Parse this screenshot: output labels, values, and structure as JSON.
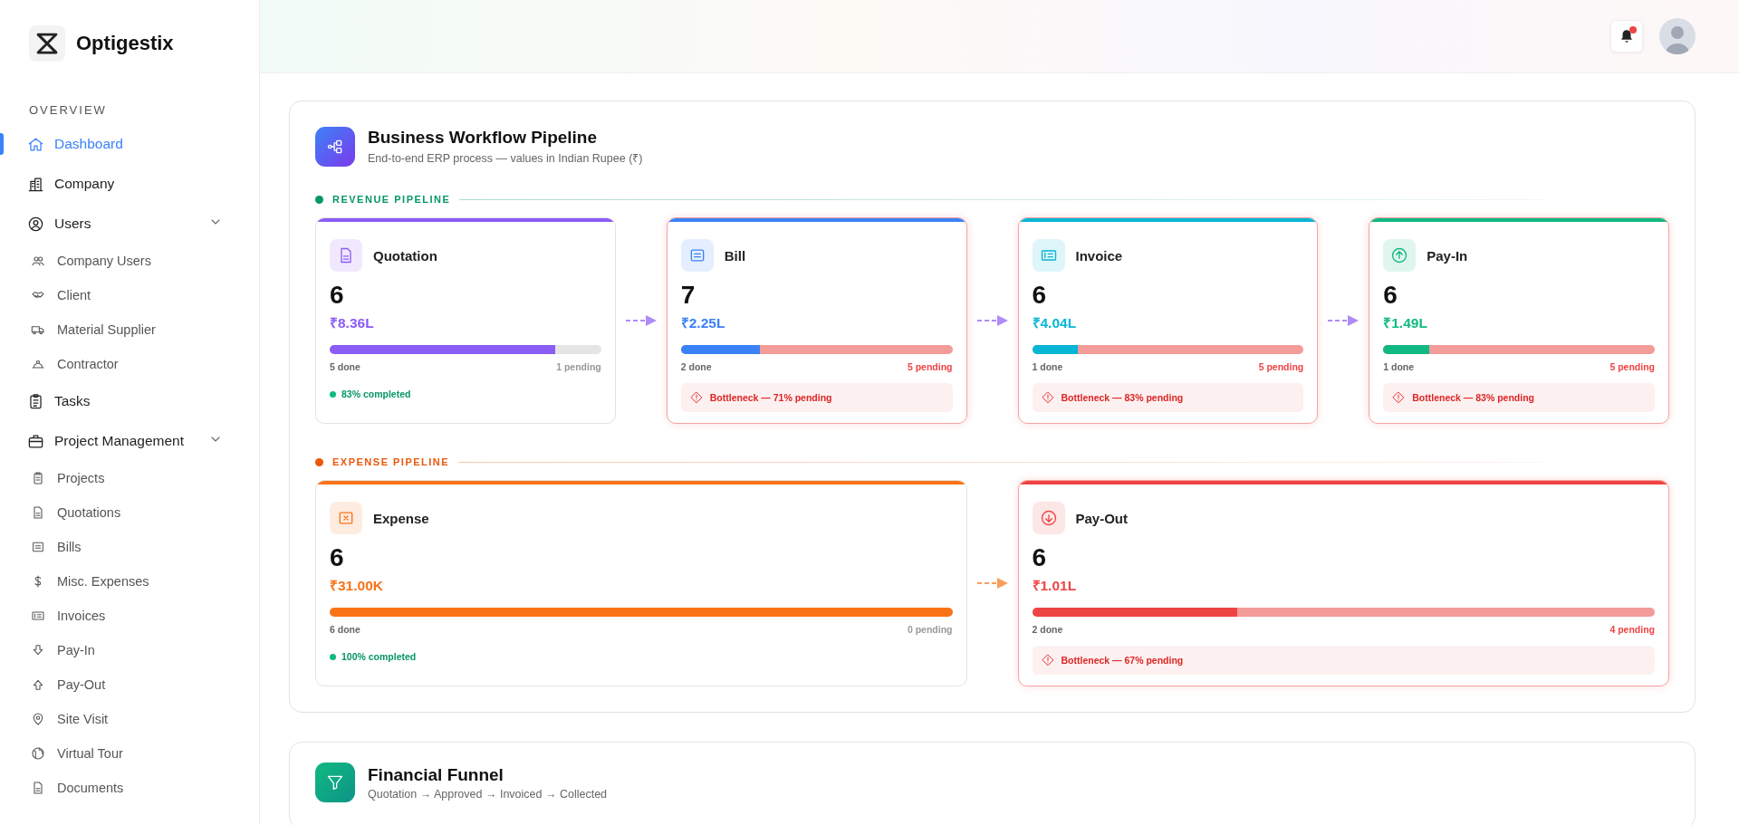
{
  "sidebar": {
    "brand": "Optigestix",
    "section_label": "OVERVIEW",
    "items": [
      {
        "label": "Dashboard",
        "selected": true
      },
      {
        "label": "Company",
        "selected": false
      },
      {
        "label": "Users",
        "selected": false,
        "expanded": true,
        "children": [
          {
            "label": "Company Users",
            "selected": false
          },
          {
            "label": "Client",
            "selected": false
          },
          {
            "label": "Material Supplier",
            "selected": false
          },
          {
            "label": "Contractor",
            "selected": false
          }
        ]
      },
      {
        "label": "Tasks",
        "selected": false
      },
      {
        "label": "Project Management",
        "selected": false,
        "expanded": true,
        "children": [
          {
            "label": "Projects",
            "selected": false
          },
          {
            "label": "Quotations",
            "selected": false
          },
          {
            "label": "Bills",
            "selected": false
          },
          {
            "label": "Misc. Expenses",
            "selected": false
          },
          {
            "label": "Invoices",
            "selected": false
          },
          {
            "label": "Pay-In",
            "selected": false
          },
          {
            "label": "Pay-Out",
            "selected": false
          },
          {
            "label": "Site Visit",
            "selected": false
          },
          {
            "label": "Virtual Tour",
            "selected": false
          },
          {
            "label": "Documents",
            "selected": false
          }
        ]
      }
    ]
  },
  "header": {
    "notifications_unread": true
  },
  "pipeline": {
    "title": "Business Workflow Pipeline",
    "subtitle": "End-to-end ERP process — values in Indian Rupee (₹)",
    "sections": [
      {
        "label": "REVENUE PIPELINE",
        "color": "#059669",
        "stages": [
          {
            "name": "Quotation",
            "kind": "complete",
            "color": "#8b5cf6",
            "count": "6",
            "amount": "₹8.36L",
            "level": 0.83,
            "done": "5 done",
            "pending": "1 pending",
            "note": "83% completed"
          },
          {
            "name": "Bill",
            "kind": "bottleneck",
            "color": "#3b82f6",
            "count": "7",
            "amount": "₹2.25L",
            "level": 0.29,
            "done": "2 done",
            "pending": "5 pending",
            "note": "Bottleneck — 71% pending"
          },
          {
            "name": "Invoice",
            "kind": "bottleneck",
            "color": "#06b6d4",
            "count": "6",
            "amount": "₹4.04L",
            "level": 0.17,
            "done": "1 done",
            "pending": "5 pending",
            "note": "Bottleneck — 83% pending"
          },
          {
            "name": "Pay-In",
            "kind": "bottleneck",
            "color": "#10b981",
            "count": "6",
            "amount": "₹1.49L",
            "level": 0.17,
            "done": "1 done",
            "pending": "5 pending",
            "note": "Bottleneck — 83% pending"
          }
        ]
      },
      {
        "label": "EXPENSE PIPELINE",
        "color": "#ea580c",
        "stages": [
          {
            "name": "Expense",
            "kind": "complete",
            "color": "#f97316",
            "count": "6",
            "amount": "₹31.00K",
            "level": 1,
            "done": "6 done",
            "pending": "0 pending",
            "note": "100% completed"
          },
          {
            "name": "Pay-Out",
            "kind": "bottleneck",
            "color": "#ef4444",
            "count": "6",
            "amount": "₹1.01L",
            "level": 0.33,
            "done": "2 done",
            "pending": "4 pending",
            "note": "Bottleneck — 67% pending"
          }
        ]
      }
    ]
  },
  "funnel": {
    "title": "Financial Funnel",
    "subtitle": "Quotation → Approved → Invoiced → Collected"
  }
}
